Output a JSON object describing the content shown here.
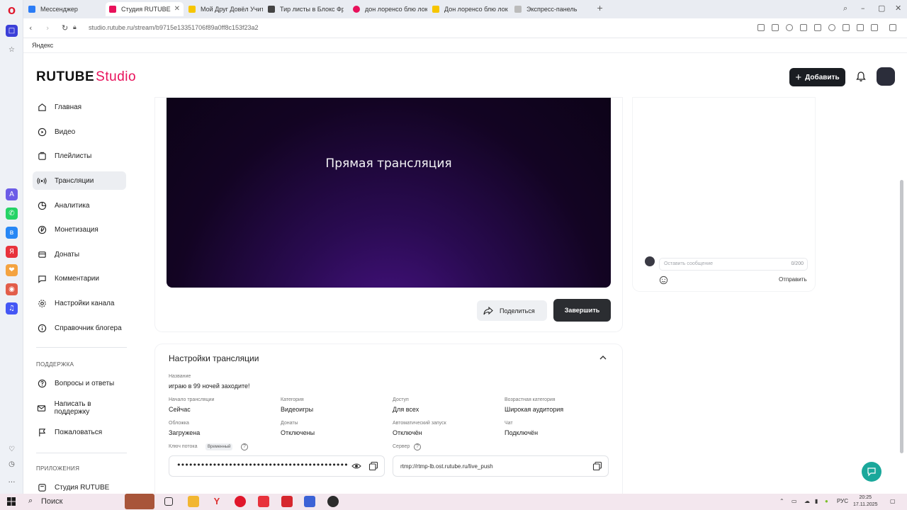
{
  "browser": {
    "tabs": [
      {
        "label": "Мессенджер",
        "color": "#2b7cf6"
      },
      {
        "label": "Студия RUTUBE",
        "color": "#e8115b",
        "active": true
      },
      {
        "label": "Мой Друг Довёл Учителе",
        "color": "#f6c500"
      },
      {
        "label": "Тир листы в Блокс Фрут",
        "color": "#444444"
      },
      {
        "label": "дон лоренсо блю лок - ",
        "color": "#e8115b"
      },
      {
        "label": "Дон лоренсо блю лок сл",
        "color": "#f6c500"
      },
      {
        "label": "Экспресс-панель",
        "color": "#888888"
      }
    ],
    "url": "studio.rutube.ru/stream/b9715e13351706f89a0ff8c153f23a2",
    "bookmark": "Яндекс"
  },
  "header": {
    "logo_main": "RUTUBE",
    "logo_studio": "Studio",
    "add_label": "Добавить",
    "brand_color": "#e8115b"
  },
  "sidebar": {
    "items": [
      {
        "label": "Главная",
        "icon": "home-icon"
      },
      {
        "label": "Видео",
        "icon": "video-icon"
      },
      {
        "label": "Плейлисты",
        "icon": "playlist-icon"
      },
      {
        "label": "Трансляции",
        "icon": "broadcast-icon",
        "active": true
      },
      {
        "label": "Аналитика",
        "icon": "analytics-icon"
      },
      {
        "label": "Монетизация",
        "icon": "ruble-icon"
      },
      {
        "label": "Донаты",
        "icon": "donate-icon"
      },
      {
        "label": "Комментарии",
        "icon": "comment-icon"
      },
      {
        "label": "Настройки канала",
        "icon": "gear-icon"
      },
      {
        "label": "Справочник блогера",
        "icon": "info-icon"
      }
    ],
    "support_heading": "Поддержка",
    "support_items": [
      {
        "label": "Вопросы и ответы",
        "icon": "question-icon"
      },
      {
        "label": "Написать в поддержку",
        "icon": "mail-icon"
      },
      {
        "label": "Пожаловаться",
        "icon": "flag-icon"
      }
    ],
    "apps_heading": "Приложения",
    "apps_items": [
      {
        "label": "Студия RUTUBE",
        "icon": "app-icon"
      }
    ]
  },
  "player": {
    "title": "Прямая трансляция",
    "share_label": "Поделиться",
    "finish_label": "Завершить"
  },
  "chat": {
    "placeholder": "Оставить сообщение",
    "counter": "0/200",
    "send_label": "Отправить"
  },
  "settings": {
    "title": "Настройки трансляции",
    "name_label": "Название",
    "name_value": "играю в 99 ночей заходите!",
    "fields": [
      {
        "label": "Начало трансляции",
        "value": "Сейчас"
      },
      {
        "label": "Категория",
        "value": "Видеоигры"
      },
      {
        "label": "Доступ",
        "value": "Для всех"
      },
      {
        "label": "Возрастная категория",
        "value": "Широкая аудитория"
      },
      {
        "label": "Обложка",
        "value": "Загружена"
      },
      {
        "label": "Донаты",
        "value": "Отключены"
      },
      {
        "label": "Автоматический запуск",
        "value": "Отключён"
      },
      {
        "label": "Чат",
        "value": "Подключён"
      }
    ],
    "key_label": "Ключ потока",
    "key_badge": "Временный",
    "key_value": "••••••••••••••••••••••••••••••••••••••••••••••••••••••••••••••••••••••••••••",
    "server_label": "Сервер",
    "server_value": "rtmp://rtmp-lb.ost.rutube.ru/live_push"
  },
  "taskbar": {
    "search": "Поиск",
    "lang": "РУС",
    "time": "20:25",
    "date": "17.11.2025"
  }
}
